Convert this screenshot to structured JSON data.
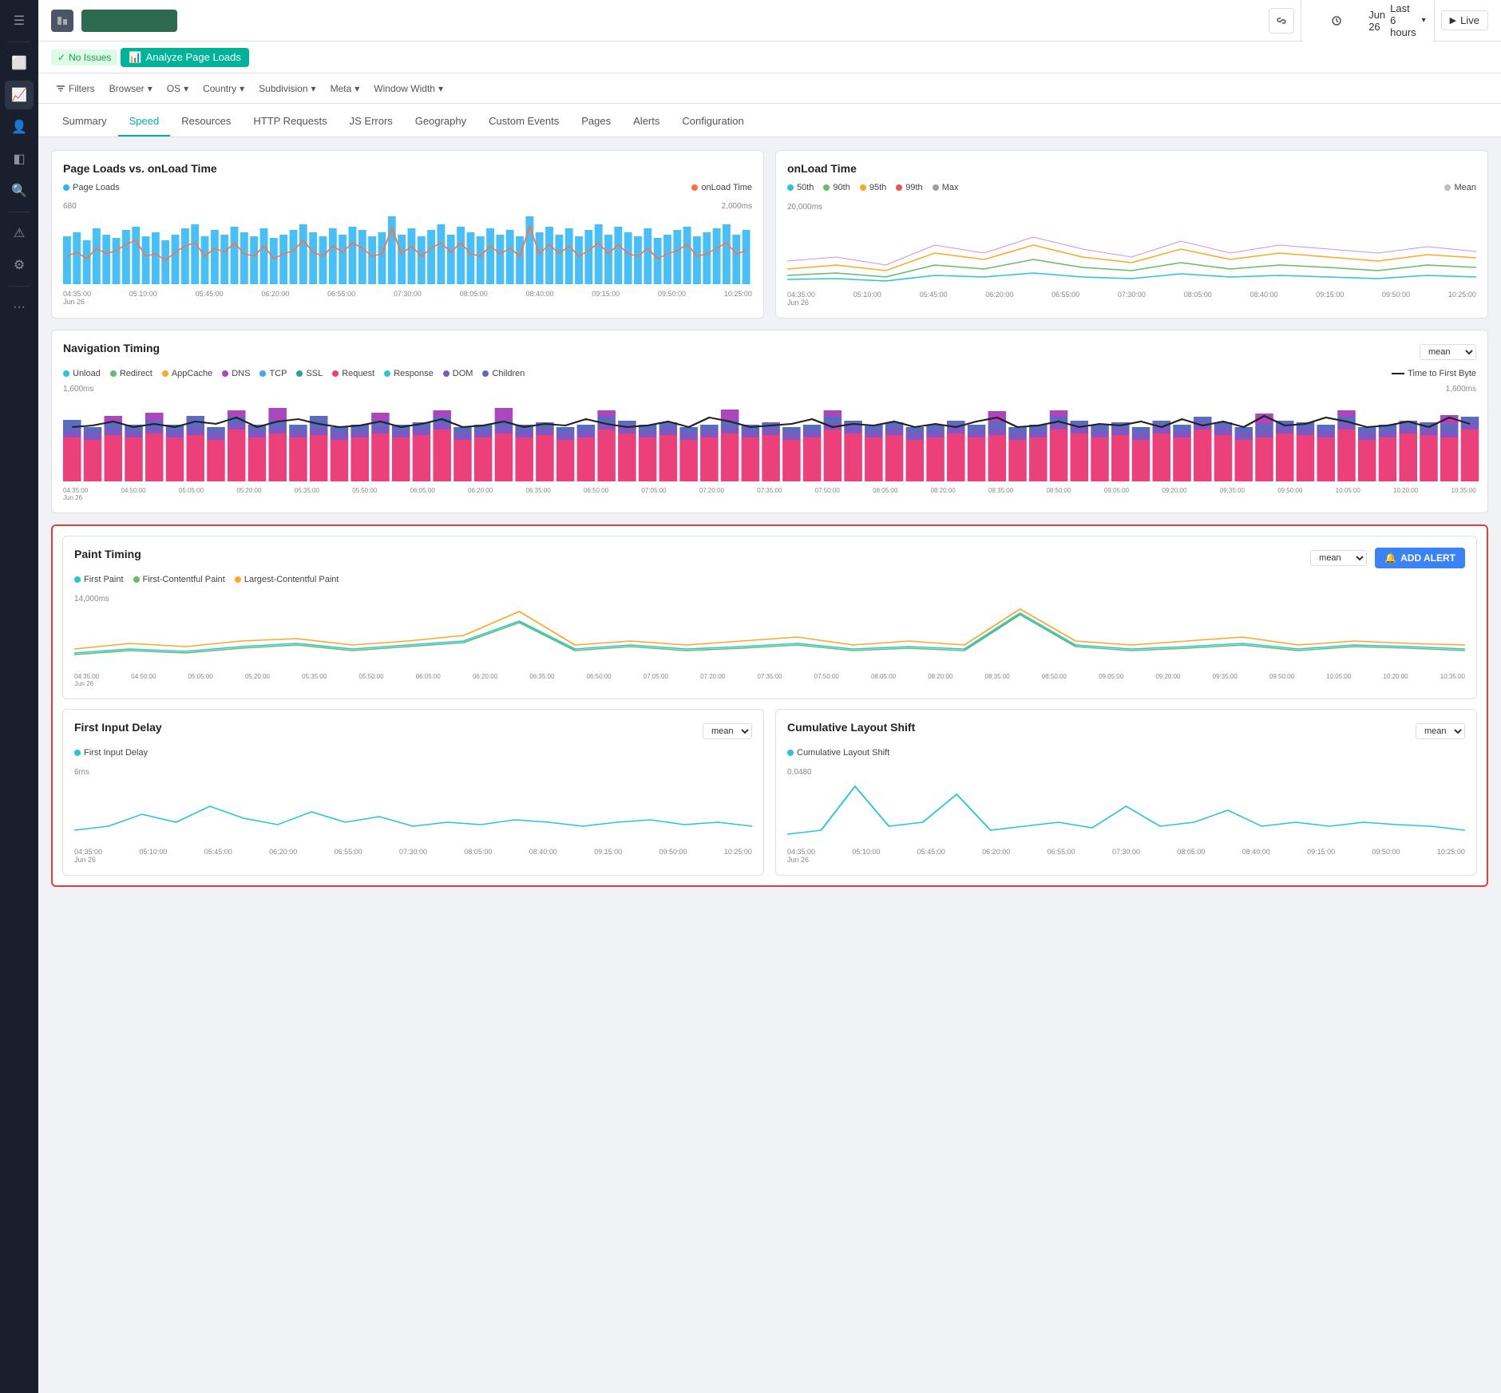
{
  "sidebar": {
    "icons": [
      {
        "name": "menu-icon",
        "symbol": "☰",
        "active": false
      },
      {
        "name": "monitor-icon",
        "symbol": "🖥",
        "active": false
      },
      {
        "name": "chart-icon",
        "symbol": "📊",
        "active": true
      },
      {
        "name": "users-icon",
        "symbol": "👥",
        "active": false
      },
      {
        "name": "layers-icon",
        "symbol": "◧",
        "active": false
      },
      {
        "name": "search-icon",
        "symbol": "🔍",
        "active": false
      },
      {
        "name": "alert-icon",
        "symbol": "⚠",
        "active": false
      },
      {
        "name": "settings-icon",
        "symbol": "⚙",
        "active": false
      },
      {
        "name": "more-icon",
        "symbol": "···",
        "active": false
      }
    ]
  },
  "topbar": {
    "date_label": "Jun 26",
    "time_range": "Last 6 hours",
    "live_label": "Live"
  },
  "subbar": {
    "status_label": "No Issues",
    "analyze_label": "Analyze Page Loads"
  },
  "filterbar": {
    "filters_label": "Filters",
    "browser_label": "Browser",
    "os_label": "OS",
    "country_label": "Country",
    "subdivision_label": "Subdivision",
    "meta_label": "Meta",
    "window_width_label": "Window Width"
  },
  "tabs": {
    "items": [
      {
        "label": "Summary",
        "active": false
      },
      {
        "label": "Speed",
        "active": true
      },
      {
        "label": "Resources",
        "active": false
      },
      {
        "label": "HTTP Requests",
        "active": false
      },
      {
        "label": "JS Errors",
        "active": false
      },
      {
        "label": "Geography",
        "active": false
      },
      {
        "label": "Custom Events",
        "active": false
      },
      {
        "label": "Pages",
        "active": false
      },
      {
        "label": "Alerts",
        "active": false
      },
      {
        "label": "Configuration",
        "active": false
      }
    ]
  },
  "page_loads_chart": {
    "title": "Page Loads vs. onLoad Time",
    "legend_page_loads": "Page Loads",
    "legend_onload": "onLoad Time",
    "y_left": "680",
    "y_right": "2,000ms",
    "x_labels": [
      "04:35:00\nJun 26",
      "05:10:00",
      "05:45:00",
      "06:20:00",
      "06:55:00",
      "07:30:00",
      "08:05:00",
      "08:40:00",
      "09:15:00",
      "09:50:00",
      "10:25:00"
    ]
  },
  "onload_time_chart": {
    "title": "onLoad Time",
    "legend": [
      "50th",
      "90th",
      "95th",
      "99th",
      "Max",
      "Mean"
    ],
    "y_left": "20,000ms",
    "x_labels": [
      "04:35:00\nJun 26",
      "05:10:00",
      "05:45:00",
      "06:20:00",
      "06:55:00",
      "07:30:00",
      "08:05:00",
      "08:40:00",
      "09:15:00",
      "09:50:00",
      "10:25:00"
    ]
  },
  "navigation_timing": {
    "title": "Navigation Timing",
    "select_value": "mean",
    "legend": [
      "Unload",
      "Redirect",
      "AppCache",
      "DNS",
      "TCP",
      "SSL",
      "Request",
      "Response",
      "DOM",
      "Children",
      "Time to First Byte"
    ],
    "y_label": "1,600ms",
    "y_right": "1,600ms",
    "x_labels": [
      "04:35:00\nJun 26",
      "04:50:00",
      "05:05:00",
      "05:20:00",
      "05:35:00",
      "05:50:00",
      "06:05:00",
      "06:20:00",
      "06:35:00",
      "06:50:00",
      "07:05:00",
      "07:20:00",
      "07:35:00",
      "07:50:00",
      "08:05:00",
      "08:20:00",
      "08:35:00",
      "08:50:00",
      "09:05:00",
      "09:20:00",
      "09:35:00",
      "09:50:00",
      "10:05:00",
      "10:20:00",
      "10:35:00"
    ]
  },
  "paint_timing": {
    "title": "Paint Timing",
    "select_value": "mean",
    "legend": [
      "First Paint",
      "First-Contentful Paint",
      "Largest-Contentful Paint"
    ],
    "add_alert_label": "ADD ALERT",
    "y_label": "14,000ms",
    "x_labels": [
      "04:35:00\nJun 26",
      "04:50:00",
      "05:05:00",
      "05:20:00",
      "05:35:00",
      "05:50:00",
      "06:05:00",
      "06:20:00",
      "06:35:00",
      "06:50:00",
      "07:05:00",
      "07:20:00",
      "07:35:00",
      "07:50:00",
      "08:05:00",
      "08:20:00",
      "08:35:00",
      "08:50:00",
      "09:05:00",
      "09:20:00",
      "09:35:00",
      "09:50:00",
      "10:05:00",
      "10:20:00",
      "10:35:00"
    ]
  },
  "first_input_delay": {
    "title": "First Input Delay",
    "select_value": "mean",
    "legend": "First Input Delay",
    "y_label": "6ms",
    "x_labels": [
      "04:35:00\nJun 26",
      "05:10:00",
      "05:45:00",
      "06:20:00",
      "06:55:00",
      "07:30:00",
      "08:05:00",
      "08:40:00",
      "09:15:00",
      "09:50:00",
      "10:25:00"
    ]
  },
  "cumulative_layout_shift": {
    "title": "Cumulative Layout Shift",
    "select_value": "mean",
    "legend": "Cumulative Layout Shift",
    "y_label": "0.0480",
    "x_labels": [
      "04:35:00\nJun 26",
      "05:10:00",
      "05:45:00",
      "06:20:00",
      "06:55:00",
      "07:30:00",
      "08:05:00",
      "08:40:00",
      "09:15:00",
      "09:50:00",
      "10:25:00"
    ]
  },
  "colors": {
    "page_loads_bar": "#29b6f6",
    "onload_line": "#ff7043",
    "p50": "#26c6da",
    "p90": "#66bb6a",
    "p95": "#ffa726",
    "p99": "#ef5350",
    "pmax": "#9e9e9e",
    "pmean": "#bdbdbd",
    "nav_unload": "#26c6da",
    "nav_redirect": "#66bb6a",
    "nav_appcache": "#ffa726",
    "nav_dns": "#ab47bc",
    "nav_tcp": "#42a5f5",
    "nav_ssl": "#26a69a",
    "nav_request": "#ec407a",
    "nav_response": "#26c6da",
    "nav_dom": "#7e57c2",
    "nav_children": "#5c6bc0",
    "nav_ttfb": "#212121",
    "first_paint": "#26c6da",
    "first_contentful": "#66bb6a",
    "largest_contentful": "#ffa726",
    "first_input": "#26c6da",
    "cls": "#26c6da",
    "accent": "#00b398",
    "highlight_border": "#e53e3e"
  }
}
